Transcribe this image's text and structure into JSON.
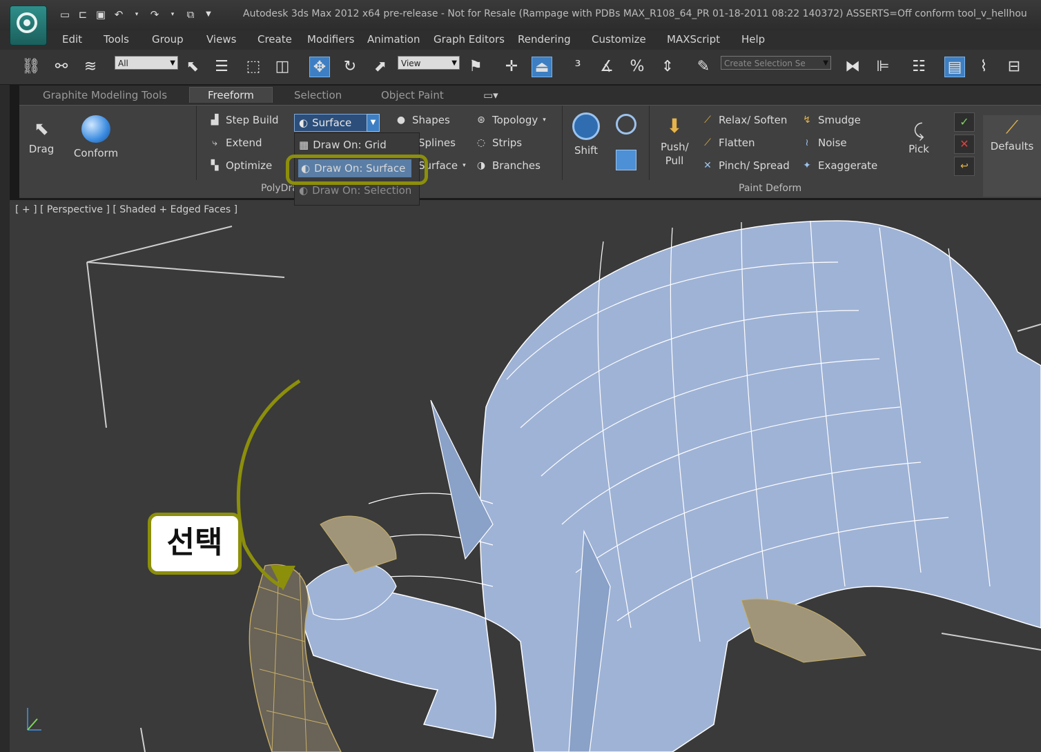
{
  "title": "Autodesk 3ds Max  2012 x64 pre-release - Not for Resale (Rampage with PDBs MAX_R108_64_PR 01-18-2011 08:22 140372) ASSERTS=Off    conform tool_v_hellhou",
  "menu": [
    "Edit",
    "Tools",
    "Group",
    "Views",
    "Create",
    "Modifiers",
    "Animation",
    "Graph Editors",
    "Rendering",
    "Customize",
    "MAXScript",
    "Help"
  ],
  "toolbar": {
    "filter": "All",
    "coord": "View",
    "selection_set": "Create Selection Se"
  },
  "ribbon_tabs": [
    "Graphite Modeling Tools",
    "Freeform",
    "Selection",
    "Object Paint"
  ],
  "ribbon": {
    "drag": "Drag",
    "conform": "Conform",
    "step_build": "Step Build",
    "extend": "Extend",
    "optimize": "Optimize",
    "poly_group": "PolyDraw",
    "surface": "Surface",
    "shapes": "Shapes",
    "splines": "Splines",
    "surface2": "Surface",
    "topology": "Topology",
    "strips": "Strips",
    "branches": "Branches",
    "shift": "Shift",
    "push_pull": "Push/ Pull",
    "relax": "Relax/ Soften",
    "flatten": "Flatten",
    "pinch": "Pinch/ Spread",
    "smudge": "Smudge",
    "noise": "Noise",
    "exaggerate": "Exaggerate",
    "paint_deform": "Paint Deform",
    "pick": "Pick",
    "defaults": "Defaults"
  },
  "dropdown": [
    "Draw On: Grid",
    "Draw On: Surface",
    "Draw On: Selection"
  ],
  "viewport_label": "[ + ] [ Perspective ] [ Shaded + Edged Faces ]",
  "callout": "선택",
  "colors": {
    "accent": "#8c8f0a",
    "mesh": "#9fb3d6",
    "selected_mesh": "#c8b068"
  }
}
